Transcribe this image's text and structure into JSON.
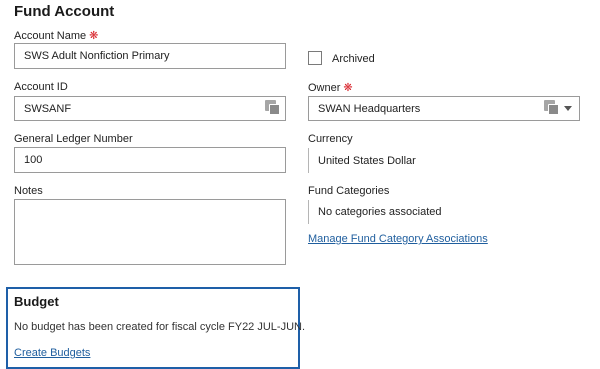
{
  "page": {
    "title": "Fund Account"
  },
  "account_name": {
    "label": "Account Name",
    "value": "SWS Adult Nonfiction Primary",
    "required_mark": "❋"
  },
  "archived": {
    "label": "Archived",
    "checked": false
  },
  "account_id": {
    "label": "Account ID",
    "value": "SWSANF",
    "icon": "lookup-icon"
  },
  "owner": {
    "label": "Owner",
    "value": "SWAN Headquarters",
    "required_mark": "❋",
    "icon": "lookup-icon"
  },
  "gl_number": {
    "label": "General Ledger Number",
    "value": "100"
  },
  "currency": {
    "label": "Currency",
    "value": "United States Dollar"
  },
  "notes": {
    "label": "Notes",
    "value": ""
  },
  "fund_categories": {
    "label": "Fund Categories",
    "value": "No categories associated",
    "manage_link": "Manage Fund Category Associations"
  },
  "budget": {
    "title": "Budget",
    "message": "No budget has been created for fiscal cycle FY22 JUL-JUN.",
    "create_link": "Create Budgets",
    "border_color": "#1e5fa8"
  },
  "colors": {
    "required": "#d9272e",
    "link": "#1f5e9e",
    "accent": "#1e5fa8"
  }
}
